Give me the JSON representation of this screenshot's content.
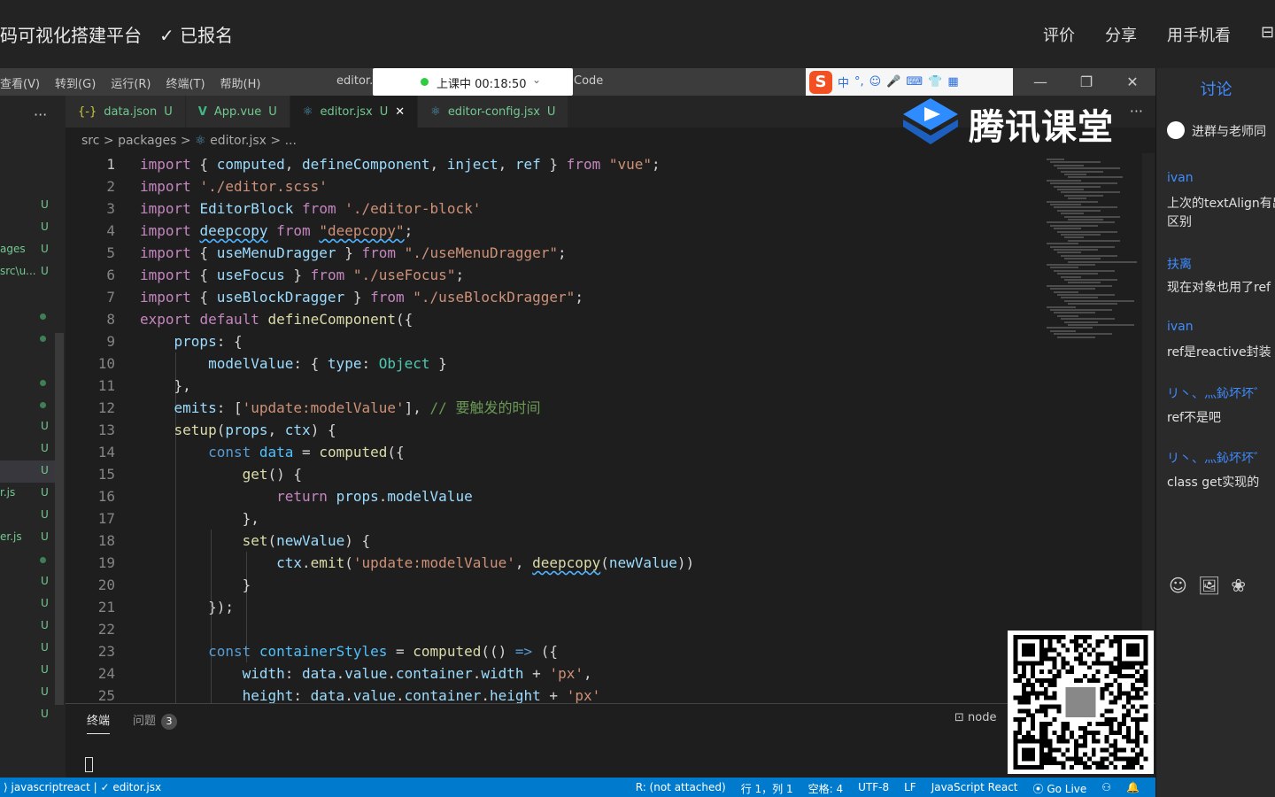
{
  "course": {
    "title": "码可视化搭建平台",
    "enrolled": "✓ 已报名",
    "links": [
      "评价",
      "分享",
      "用手机看",
      "⊟"
    ]
  },
  "menubar": {
    "menus": [
      "查看(V)",
      "转到(G)",
      "运行(R)",
      "终端(T)",
      "帮助(H)"
    ],
    "title_left": "editor.",
    "title_right": "Code",
    "controls": [
      "—",
      "❐",
      "✕"
    ]
  },
  "class_timer": {
    "text": "上课中 00:18:50",
    "chevron": "⌄"
  },
  "ime": {
    "items": [
      "中",
      "°,",
      "☺",
      "🎤",
      "⌨",
      "👕",
      "▦"
    ],
    "logo": "S"
  },
  "branding": {
    "name": "腾讯课堂"
  },
  "explorer": {
    "more": "···",
    "rows": [
      {
        "name": "",
        "status": "U"
      },
      {
        "name": "",
        "status": "U"
      },
      {
        "name": "ages",
        "status": "U"
      },
      {
        "name": "src\\u...",
        "status": "U"
      },
      {
        "name": "",
        "status": ""
      },
      {
        "name": "",
        "status": "•"
      },
      {
        "name": "",
        "status": "•"
      },
      {
        "name": "",
        "status": ""
      },
      {
        "name": "",
        "status": "•"
      },
      {
        "name": "",
        "status": "•"
      },
      {
        "name": "",
        "status": "U"
      },
      {
        "name": "",
        "status": "U"
      },
      {
        "name": "",
        "status": "U"
      },
      {
        "name": "r.js",
        "status": "U"
      },
      {
        "name": "",
        "status": "U"
      },
      {
        "name": "er.js",
        "status": "U"
      },
      {
        "name": "",
        "status": "•"
      },
      {
        "name": "",
        "status": "U"
      },
      {
        "name": "",
        "status": "U"
      },
      {
        "name": "",
        "status": "U"
      },
      {
        "name": "",
        "status": "U"
      },
      {
        "name": "",
        "status": "U"
      },
      {
        "name": "",
        "status": "U"
      },
      {
        "name": "",
        "status": "U"
      }
    ]
  },
  "tabs": [
    {
      "icon": "{-}",
      "label": "data.json",
      "status": "U"
    },
    {
      "icon": "V",
      "label": "App.vue",
      "status": "U"
    },
    {
      "icon": "⚛",
      "label": "editor.jsx",
      "status": "U",
      "close": "✕"
    },
    {
      "icon": "⚛",
      "label": "editor-config.jsx",
      "status": "U"
    }
  ],
  "tabs_more": "···",
  "breadcrumb": {
    "parts": "src > packages >",
    "file": "editor.jsx",
    "tail": "> ..."
  },
  "editor": {
    "line_numbers": [
      "1",
      "2",
      "3",
      "4",
      "5",
      "6",
      "7",
      "8",
      "9",
      "10",
      "11",
      "12",
      "13",
      "14",
      "15",
      "16",
      "17",
      "18",
      "19",
      "20",
      "21",
      "22",
      "23",
      "24",
      "25"
    ],
    "comment_line12": "// 要触发的时间"
  },
  "panel": {
    "terminal": "终端",
    "problems": "问题",
    "problem_count": "3",
    "terminal_name": "node"
  },
  "status": {
    "left": "⟩ javascriptreact | ✓ editor.jsx",
    "items": [
      "R: (not attached)",
      "行 1，列 1",
      "空格: 4",
      "UTF-8",
      "LF",
      "JavaScript React",
      "⦿ Go Live",
      "⚇",
      "🔔"
    ]
  },
  "discussion": {
    "title": "讨论",
    "group": "进群与老师同",
    "messages": [
      {
        "user": "ivan",
        "text": "上次的textAlign有出区别"
      },
      {
        "user": "扶离",
        "text": "现在对象也用了ref"
      },
      {
        "user": "ivan",
        "text": "ref是reactive封装"
      },
      {
        "user": "リ丶、灬鈊坏坏゛",
        "text": "ref不是吧"
      },
      {
        "user": "リ丶、灬鈊坏坏゛",
        "text": "class get实现的"
      }
    ],
    "tools": [
      "☺",
      "🖼",
      "❀"
    ]
  }
}
